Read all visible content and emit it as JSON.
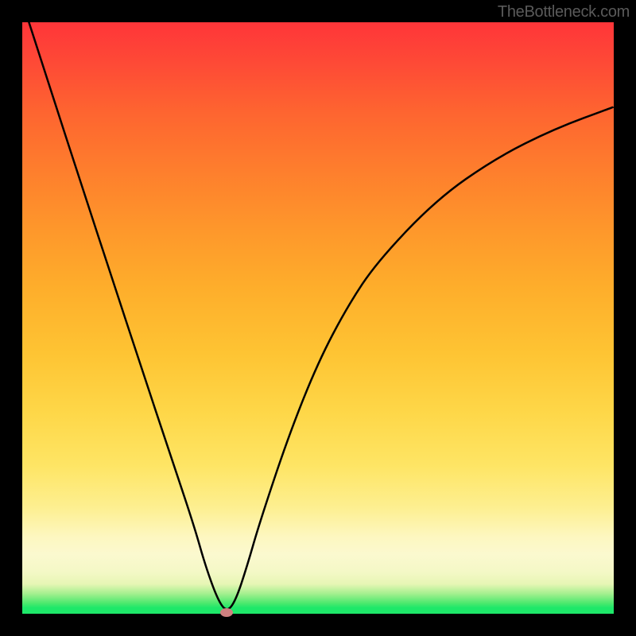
{
  "attribution": "TheBottleneck.com",
  "colors": {
    "top": "#ff3539",
    "mid": "#fee565",
    "bottom": "#1ee869",
    "curve": "#000000",
    "marker": "#cf8080",
    "background": "#000000"
  },
  "chart_data": {
    "type": "line",
    "title": "",
    "xlabel": "",
    "ylabel": "",
    "xlim": [
      0,
      1
    ],
    "ylim": [
      0,
      1
    ],
    "series": [
      {
        "name": "bottleneck-curve",
        "x": [
          0.0,
          0.05,
          0.1,
          0.15,
          0.2,
          0.25,
          0.29,
          0.31,
          0.33,
          0.345,
          0.36,
          0.38,
          0.4,
          0.45,
          0.5,
          0.55,
          0.6,
          0.7,
          0.8,
          0.9,
          1.0
        ],
        "values": [
          1.035,
          0.88,
          0.725,
          0.573,
          0.42,
          0.27,
          0.15,
          0.08,
          0.025,
          0.003,
          0.02,
          0.08,
          0.15,
          0.3,
          0.425,
          0.52,
          0.595,
          0.7,
          0.77,
          0.82,
          0.857
        ]
      }
    ],
    "marker": {
      "x": 0.345,
      "y": 0.003
    }
  }
}
